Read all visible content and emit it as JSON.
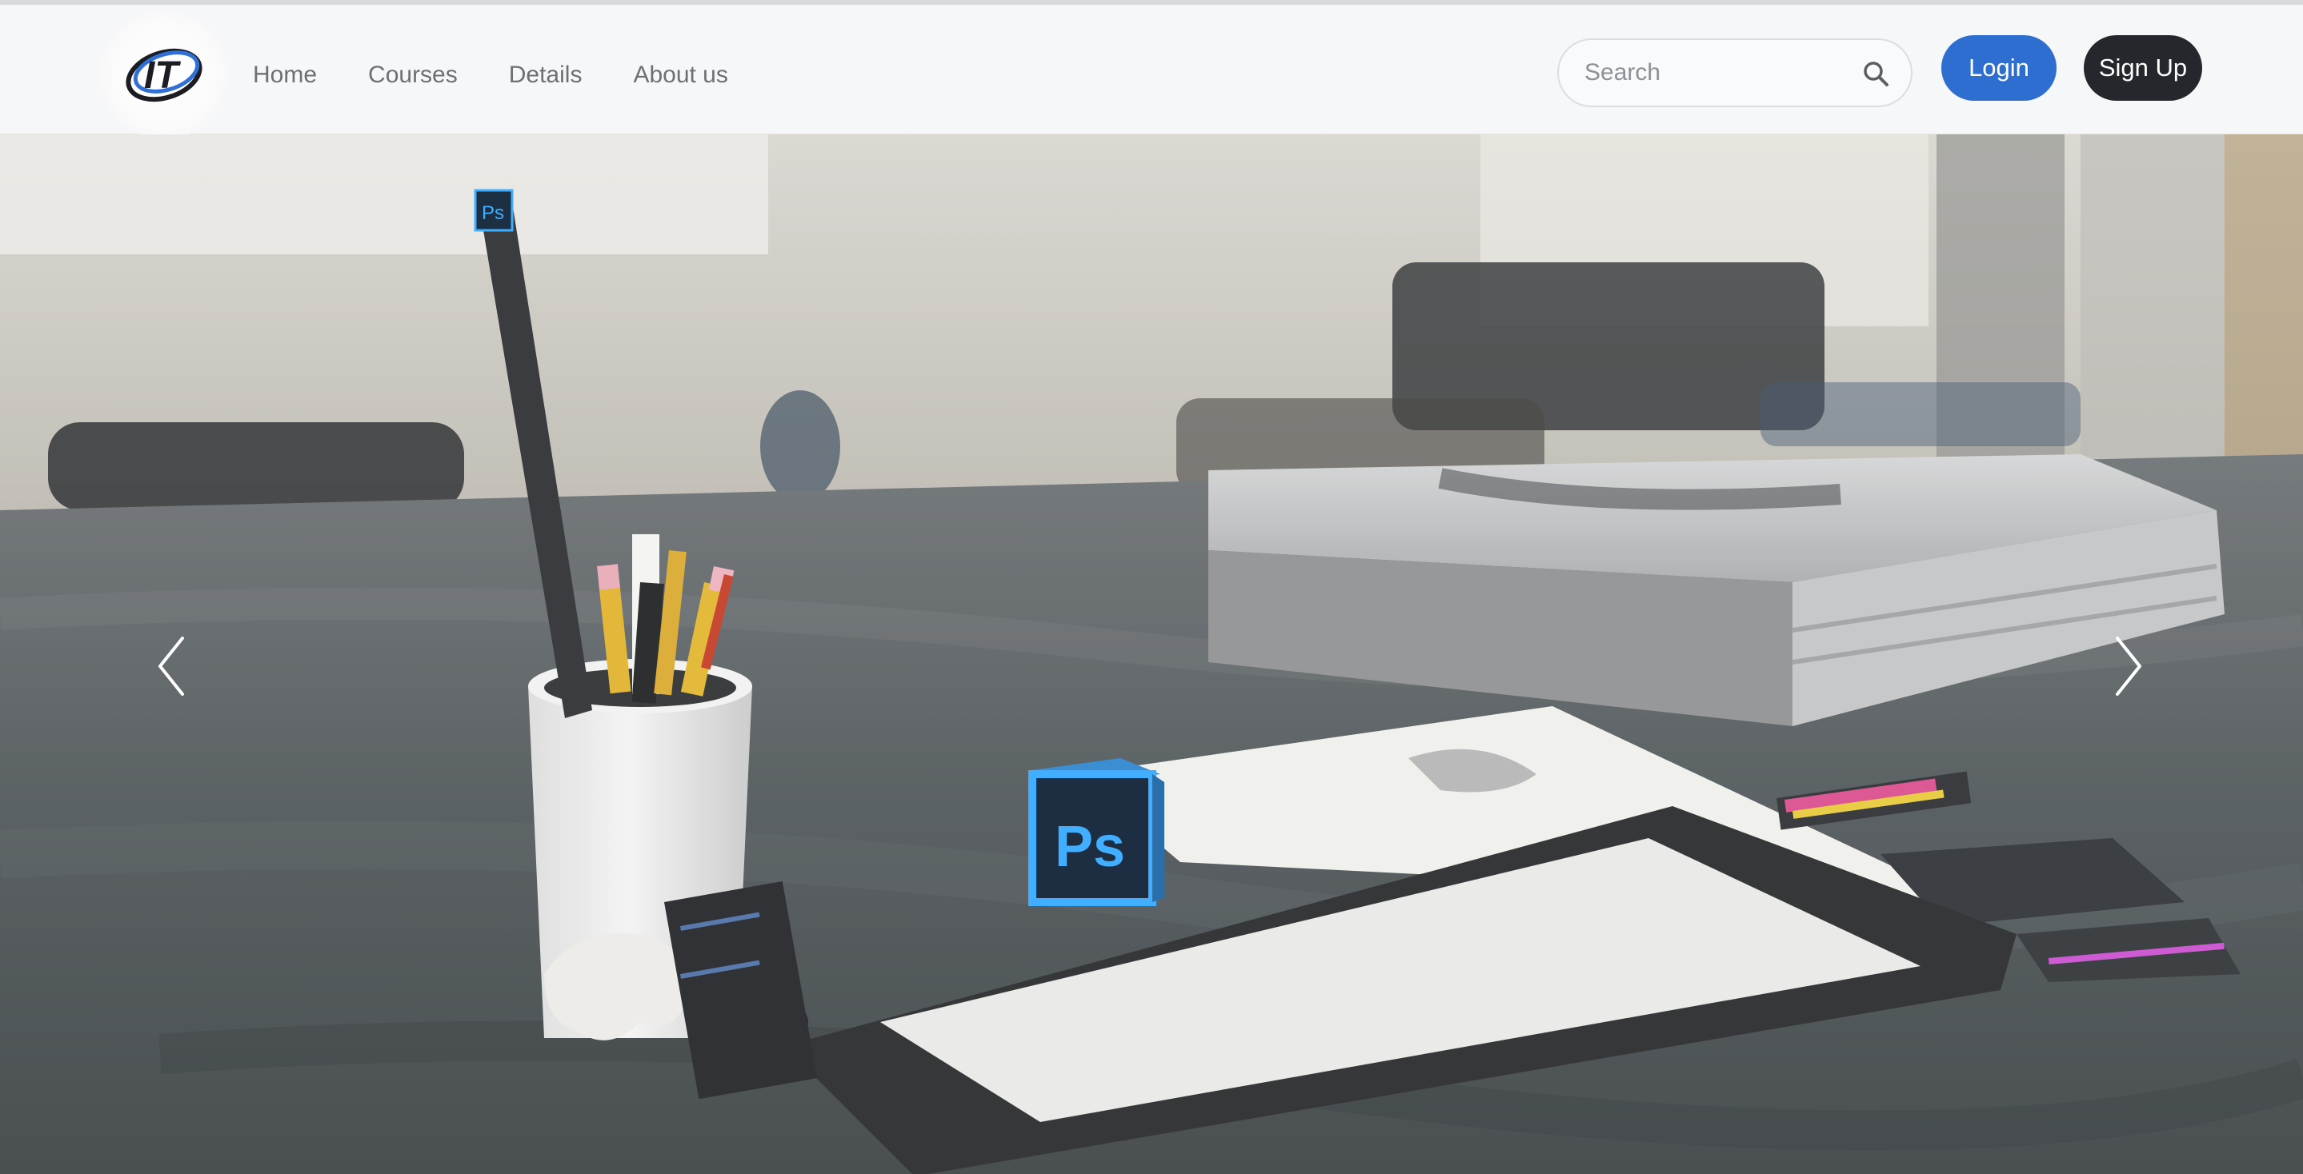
{
  "brand": {
    "logo_text": "IT"
  },
  "nav": {
    "items": [
      {
        "label": "Home"
      },
      {
        "label": "Courses"
      },
      {
        "label": "Details"
      },
      {
        "label": "About us"
      }
    ]
  },
  "search": {
    "placeholder": "Search",
    "value": ""
  },
  "auth": {
    "login_label": "Login",
    "signup_label": "Sign Up"
  },
  "hero": {
    "cube_label": "Ps",
    "ruler_label": "Ps"
  },
  "colors": {
    "login_bg": "#2e6ed1",
    "signup_bg": "#24272b",
    "nav_text": "#6d6f73",
    "ps_blue": "#31a8ff"
  },
  "icons": {
    "search": "search-icon",
    "prev": "chevron-left-icon",
    "next": "chevron-right-icon"
  }
}
